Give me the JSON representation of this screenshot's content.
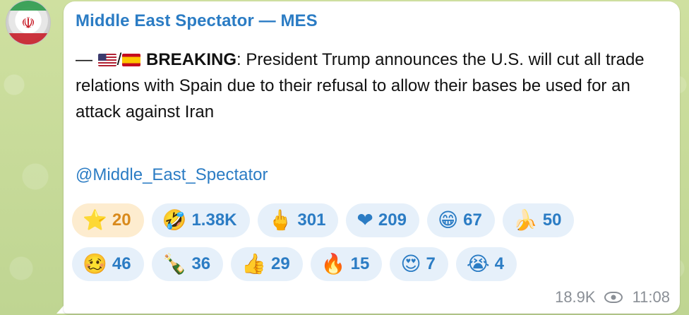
{
  "channel": {
    "avatar_icon": "iran-flag-emblem",
    "emblem_glyph": "☫"
  },
  "message": {
    "sender": "Middle East Spectator — MES",
    "dash": "—",
    "flag1": "us-flag",
    "slash": "/",
    "flag2": "spain-flag",
    "breaking_label": "BREAKING",
    "colon": ":",
    "body": " President Trump announces the U.S. will cut all trade relations with Spain due to their refusal to allow their bases be used for an attack against Iran",
    "link": "@Middle_East_Spectator"
  },
  "reactions": {
    "row1": [
      {
        "emoji": "⭐",
        "icon": "star-reaction-icon",
        "count": "20",
        "active": true
      },
      {
        "emoji": "🤣",
        "icon": "rofl-reaction-icon",
        "count": "1.38K"
      },
      {
        "emoji": "🖕",
        "icon": "middle-finger-reaction-icon",
        "count": "301"
      },
      {
        "emoji": "❤",
        "icon": "heart-reaction-icon",
        "count": "209"
      },
      {
        "emoji": "😁",
        "icon": "grin-reaction-icon",
        "count": "67"
      },
      {
        "emoji": "🍌",
        "icon": "banana-reaction-icon",
        "count": "50"
      }
    ],
    "row2": [
      {
        "emoji": "🥴",
        "icon": "woozy-reaction-icon",
        "count": "46"
      },
      {
        "emoji": "🍾",
        "icon": "champagne-reaction-icon",
        "count": "36"
      },
      {
        "emoji": "👍",
        "icon": "thumbs-up-reaction-icon",
        "count": "29"
      },
      {
        "emoji": "🔥",
        "icon": "fire-reaction-icon",
        "count": "15"
      },
      {
        "emoji": "😍",
        "icon": "heart-eyes-reaction-icon",
        "count": "7"
      },
      {
        "emoji": "😭",
        "icon": "crying-reaction-icon",
        "count": "4"
      }
    ]
  },
  "meta": {
    "views": "18.9K",
    "views_icon": "eye-icon",
    "time": "11:08"
  },
  "colors": {
    "accent": "#2b7cc4",
    "active_reaction": "#d98a1c",
    "background": "#c9dc9a"
  }
}
